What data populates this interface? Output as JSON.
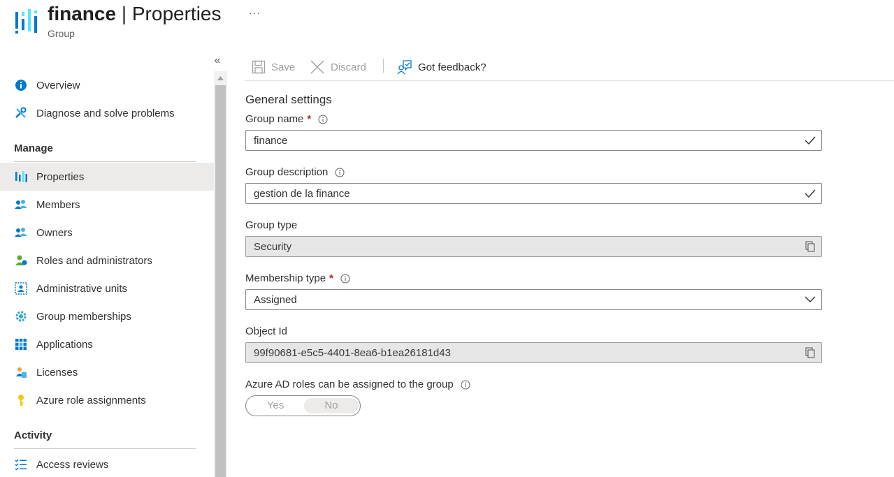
{
  "header": {
    "resource_name": "finance",
    "separator": "|",
    "page_name": "Properties",
    "subtitle": "Group",
    "more": "···"
  },
  "sidebar": {
    "collapse_label": "«",
    "items_top": [
      {
        "label": "Overview",
        "icon": "info-icon"
      },
      {
        "label": "Diagnose and solve problems",
        "icon": "wrench-icon"
      }
    ],
    "manage_heading": "Manage",
    "manage_items": [
      {
        "label": "Properties",
        "icon": "properties-icon",
        "selected": true
      },
      {
        "label": "Members",
        "icon": "members-icon"
      },
      {
        "label": "Owners",
        "icon": "owners-icon"
      },
      {
        "label": "Roles and administrators",
        "icon": "roles-icon"
      },
      {
        "label": "Administrative units",
        "icon": "admin-units-icon"
      },
      {
        "label": "Group memberships",
        "icon": "gear-icon"
      },
      {
        "label": "Applications",
        "icon": "apps-grid-icon"
      },
      {
        "label": "Licenses",
        "icon": "licenses-icon"
      },
      {
        "label": "Azure role assignments",
        "icon": "key-icon"
      }
    ],
    "activity_heading": "Activity",
    "activity_items": [
      {
        "label": "Access reviews",
        "icon": "checklist-icon"
      }
    ]
  },
  "toolbar": {
    "save_label": "Save",
    "save_enabled": false,
    "discard_label": "Discard",
    "discard_enabled": false,
    "feedback_label": "Got feedback?"
  },
  "form": {
    "section_title": "General settings",
    "group_name_label": "Group name",
    "group_name_required": "*",
    "group_name_value": "finance",
    "group_description_label": "Group description",
    "group_description_value": "gestion de la finance",
    "group_type_label": "Group type",
    "group_type_value": "Security",
    "membership_type_label": "Membership type",
    "membership_type_required": "*",
    "membership_type_value": "Assigned",
    "object_id_label": "Object Id",
    "object_id_value": "99f90681-e5c5-4401-8ea6-b1ea26181d43",
    "azure_ad_roles_label": "Azure AD roles can be assigned to the group",
    "azure_ad_roles_options": [
      "Yes",
      "No"
    ],
    "azure_ad_roles_selected": "No"
  },
  "colors": {
    "azure_blue": "#0078d4",
    "required_red": "#a4262c",
    "selected_bg": "#edebe9",
    "readonly_bg": "#e6e6e6"
  }
}
